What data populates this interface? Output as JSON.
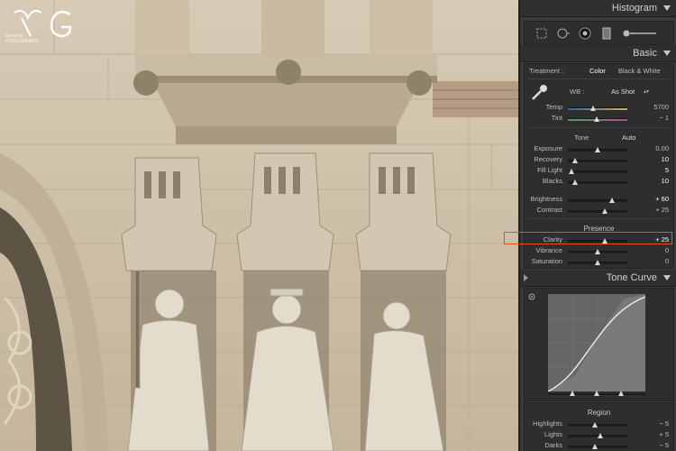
{
  "watermark": {
    "monogram": "G",
    "name": "Gergely POZSVARNOV"
  },
  "panels": {
    "histogram": {
      "title": "Histogram"
    },
    "basic": {
      "title": "Basic",
      "treatment": {
        "label": "Treatment :",
        "options": [
          "Color",
          "Black & White"
        ],
        "selected": "Color"
      },
      "wb": {
        "label": "WB :",
        "value": "As Shot"
      },
      "white_balance": [
        {
          "name": "Temp",
          "value": "5700",
          "level": 0.42
        },
        {
          "name": "Tint",
          "value": "− 1",
          "level": 0.48
        }
      ],
      "tone": {
        "label": "Tone",
        "auto": "Auto",
        "sliders": [
          {
            "name": "Exposure",
            "value": "0.00",
            "level": 0.5
          },
          {
            "name": "Recovery",
            "value": "10",
            "level": 0.12
          },
          {
            "name": "Fill Light",
            "value": "5",
            "level": 0.06
          },
          {
            "name": "Blacks",
            "value": "10",
            "level": 0.12
          }
        ],
        "brightness": [
          {
            "name": "Brightness",
            "value": "+ 60",
            "level": 0.74
          },
          {
            "name": "Contrast",
            "value": "+ 25",
            "level": 0.62
          }
        ]
      },
      "presence": {
        "label": "Presence",
        "sliders": [
          {
            "name": "Clarity",
            "value": "+ 25",
            "level": 0.62
          },
          {
            "name": "Vibrance",
            "value": "0",
            "level": 0.5
          },
          {
            "name": "Saturation",
            "value": "0",
            "level": 0.5
          }
        ]
      }
    },
    "tone_curve": {
      "title": "Tone Curve"
    },
    "region": {
      "label": "Region",
      "sliders": [
        {
          "name": "Highlights",
          "value": "− 5",
          "level": 0.45
        },
        {
          "name": "Lights",
          "value": "+ 5",
          "level": 0.55
        },
        {
          "name": "Darks",
          "value": "− 5",
          "level": 0.45
        }
      ]
    }
  },
  "colors": {
    "panel_bg": "#3a3a3a",
    "section_bg": "#2e2e2e",
    "highlight": "#e2541d"
  }
}
